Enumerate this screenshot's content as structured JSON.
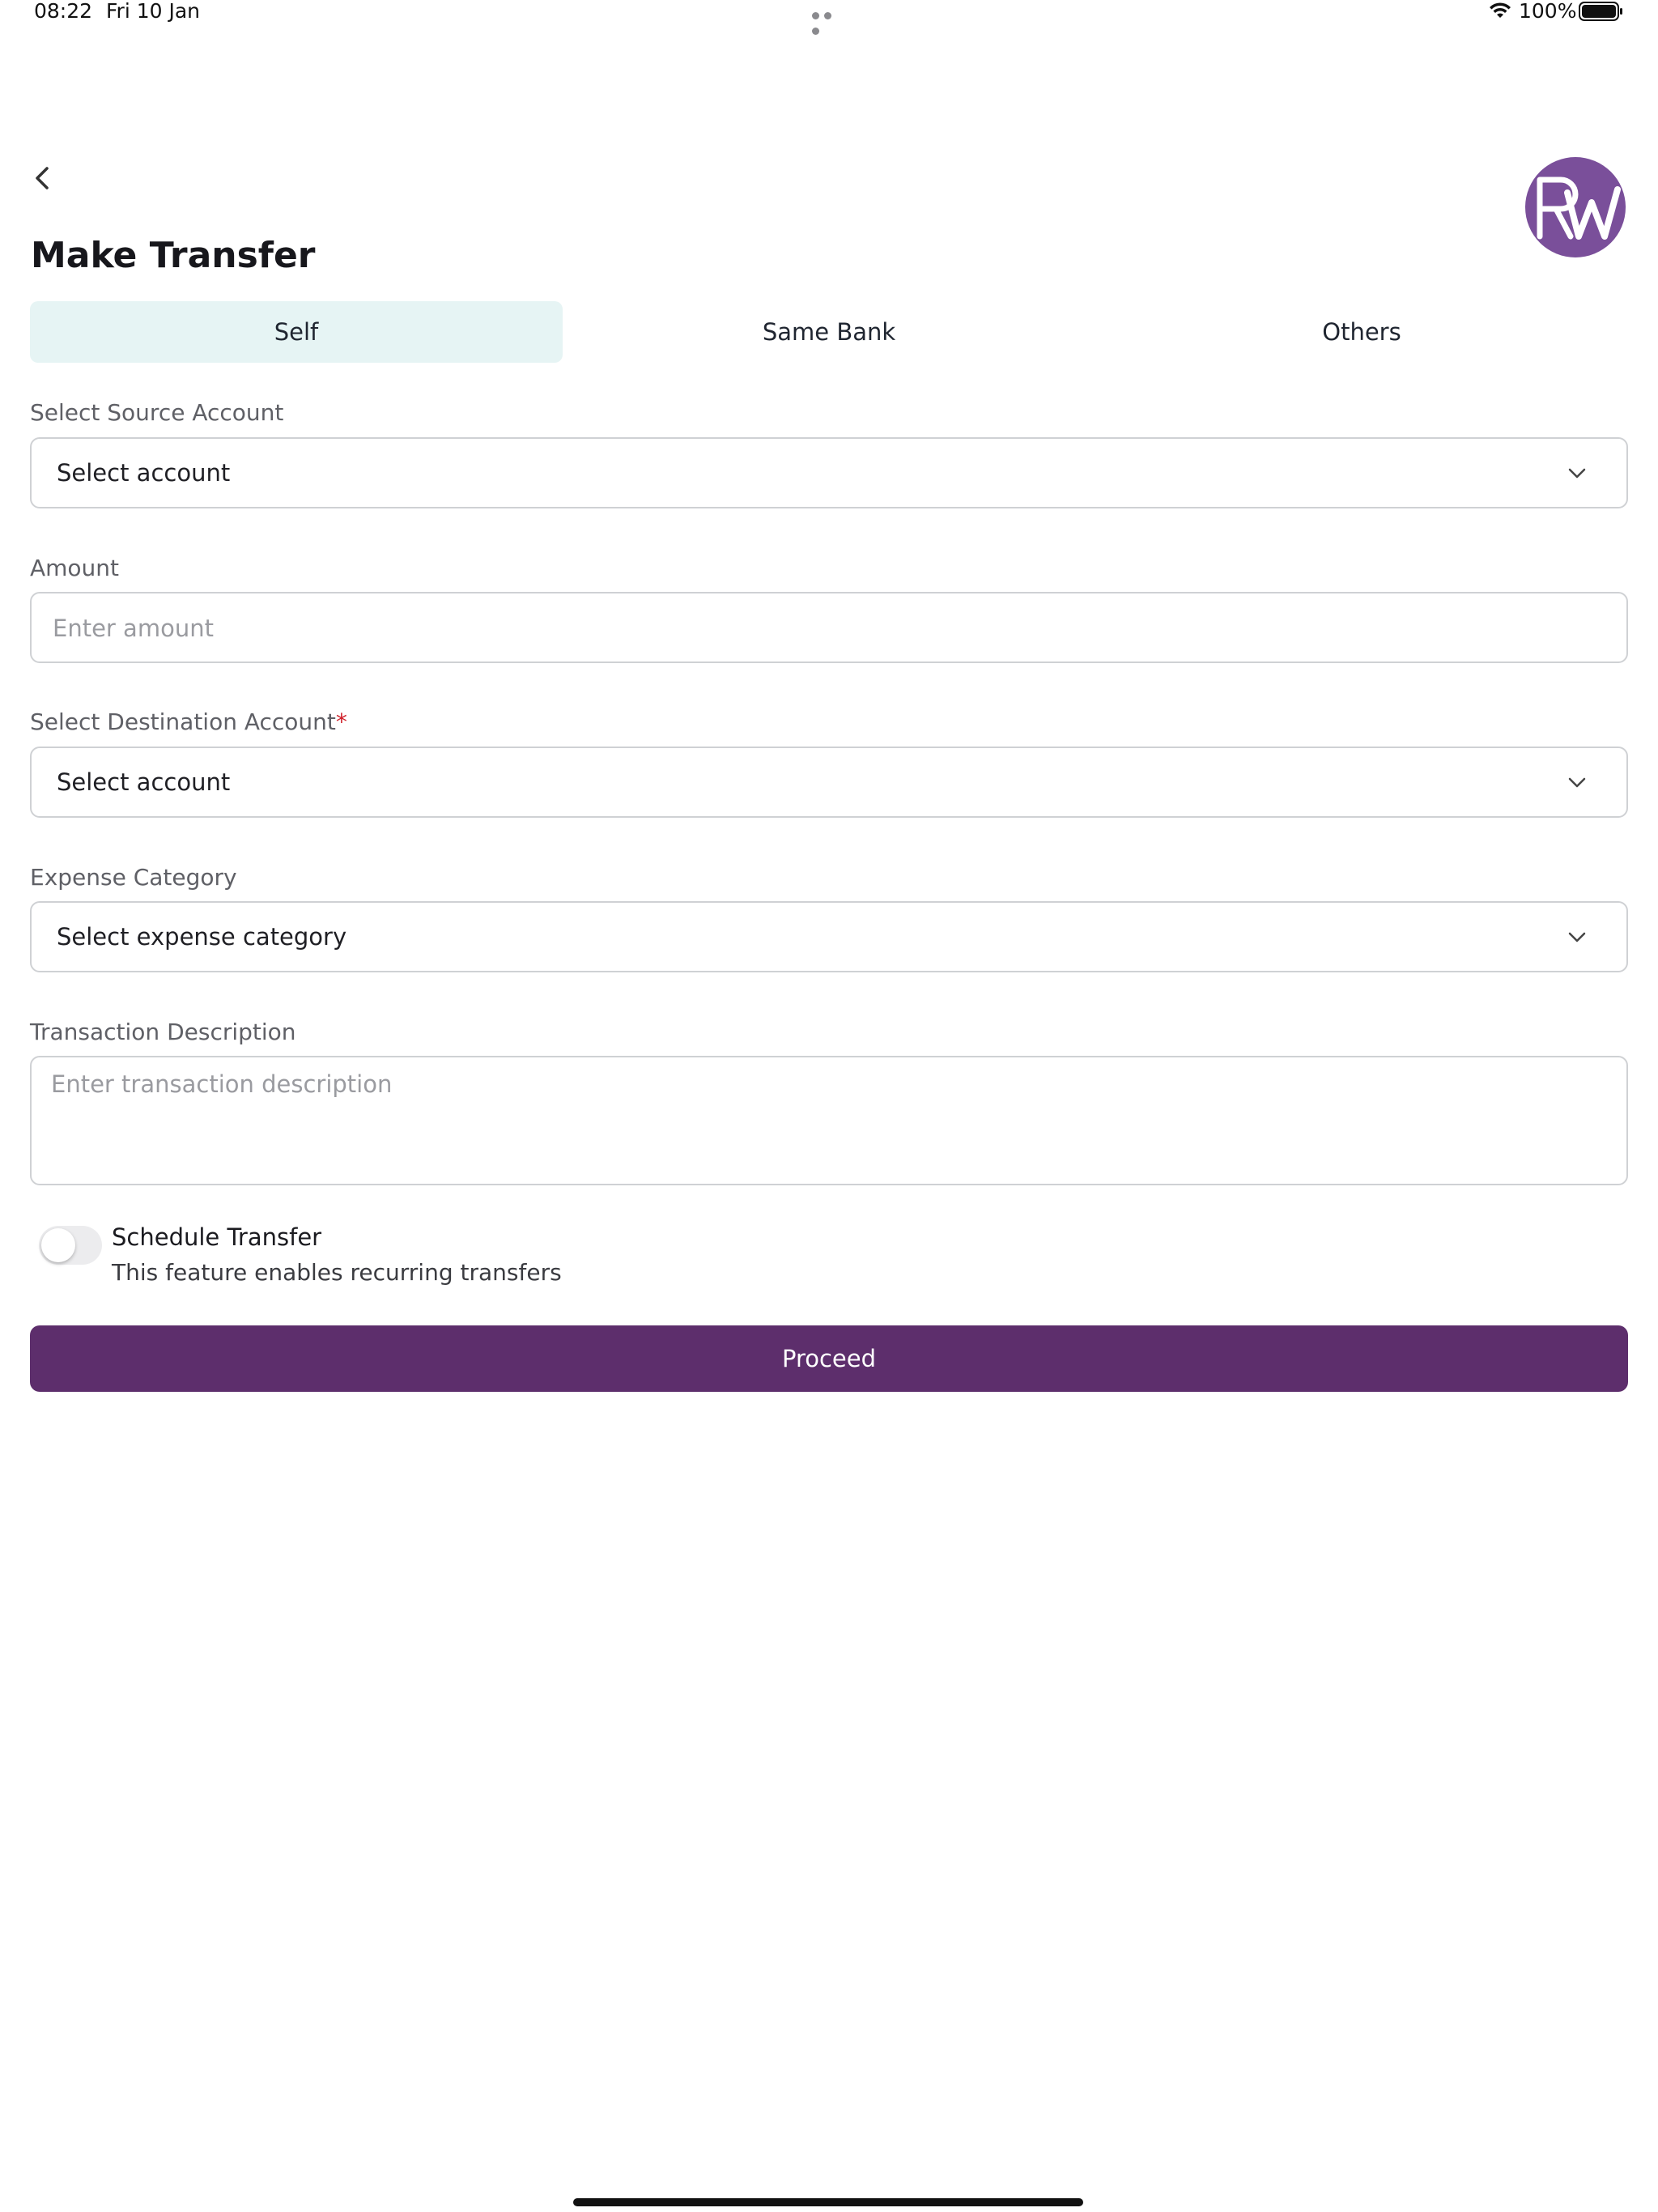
{
  "status_bar": {
    "time": "08:22",
    "date": "Fri 10 Jan",
    "battery": "100%"
  },
  "header": {
    "title": "Make Transfer",
    "logo_text": "RW"
  },
  "tabs": [
    {
      "label": "Self",
      "active": true
    },
    {
      "label": "Same Bank",
      "active": false
    },
    {
      "label": "Others",
      "active": false
    }
  ],
  "form": {
    "source_account": {
      "label": "Select Source Account",
      "value": "Select account"
    },
    "amount": {
      "label": "Amount",
      "placeholder": "Enter amount",
      "value": ""
    },
    "destination_account": {
      "label": "Select Destination Account",
      "required_marker": "*",
      "value": "Select account"
    },
    "expense_category": {
      "label": "Expense Category",
      "value": "Select expense category"
    },
    "description": {
      "label": "Transaction Description",
      "placeholder": "Enter transaction description",
      "value": ""
    },
    "schedule": {
      "title": "Schedule Transfer",
      "description": "This feature enables recurring transfers",
      "enabled": false
    }
  },
  "actions": {
    "proceed_label": "Proceed"
  },
  "colors": {
    "brand": "#5d2e6c",
    "active_tab_bg": "#e6f4f4",
    "logo": "#7a4f9a",
    "required": "#d0202a"
  }
}
